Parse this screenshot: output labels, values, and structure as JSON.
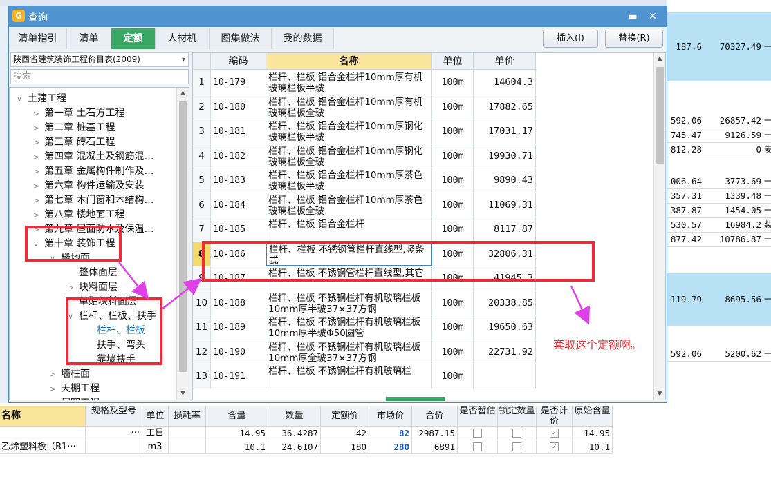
{
  "dialog": {
    "title": "查询",
    "minimize_glyph": "▬",
    "close_glyph": "✕",
    "tabs": [
      "清单指引",
      "清单",
      "定额",
      "人材机",
      "图集做法",
      "我的数据"
    ],
    "active_tab": 2,
    "insert_label": "插入(I)",
    "replace_label": "替换(R)"
  },
  "left_panel": {
    "catalog_select": "陕西省建筑装饰工程价目表(2009)",
    "search_placeholder": "搜索",
    "tree": [
      {
        "label": "土建工程",
        "level": 0,
        "expander": "∨"
      },
      {
        "label": "第一章  土石方工程",
        "level": 1,
        "expander": ">"
      },
      {
        "label": "第二章  桩基工程",
        "level": 1,
        "expander": ">"
      },
      {
        "label": "第三章  砖石工程",
        "level": 1,
        "expander": ">"
      },
      {
        "label": "第四章  混凝土及钢筋混…",
        "level": 1,
        "expander": ">"
      },
      {
        "label": "第五章  金属构件制作及…",
        "level": 1,
        "expander": ">"
      },
      {
        "label": "第六章  构件运输及安装",
        "level": 1,
        "expander": ">"
      },
      {
        "label": "第七章  木门窗和木结构…",
        "level": 1,
        "expander": ">"
      },
      {
        "label": "第八章  楼地面工程",
        "level": 1,
        "expander": ">"
      },
      {
        "label": "第九章  屋面防水及保温…",
        "level": 1,
        "expander": ">"
      },
      {
        "label": "第十章  装饰工程",
        "level": 1,
        "expander": "∨"
      },
      {
        "label": "楼地面",
        "level": 2,
        "expander": "∨"
      },
      {
        "label": "整体面层",
        "level": 3,
        "expander": ""
      },
      {
        "label": "块料面层",
        "level": 3,
        "expander": ">"
      },
      {
        "label": "单贴块料面层",
        "level": 3,
        "expander": ""
      },
      {
        "label": "栏杆、栏板、扶手",
        "level": 3,
        "expander": "∨"
      },
      {
        "label": "栏杆、栏板",
        "level": 4,
        "expander": "",
        "selected": true
      },
      {
        "label": "扶手、弯头",
        "level": 4,
        "expander": ""
      },
      {
        "label": "靠墙扶手",
        "level": 4,
        "expander": ""
      },
      {
        "label": "墙柱面",
        "level": 2,
        "expander": ">"
      },
      {
        "label": "天棚工程",
        "level": 2,
        "expander": ">"
      },
      {
        "label": "门窗工程",
        "level": 2,
        "expander": ">"
      }
    ]
  },
  "grid": {
    "headers": [
      "",
      "编码",
      "名称",
      "单位",
      "单价"
    ],
    "rows": [
      {
        "num": "1",
        "code": "10-179",
        "name": "栏杆、栏板 铝合金栏杆10mm厚有机玻璃栏板半玻",
        "unit": "100m",
        "price": "14604.3"
      },
      {
        "num": "2",
        "code": "10-180",
        "name": "栏杆、栏板 铝合金栏杆10mm厚有机玻璃栏板全玻",
        "unit": "100m",
        "price": "17882.65"
      },
      {
        "num": "3",
        "code": "10-181",
        "name": "栏杆、栏板 铝合金栏杆10mm厚钢化玻璃栏板半玻",
        "unit": "100m",
        "price": "17031.17"
      },
      {
        "num": "4",
        "code": "10-182",
        "name": "栏杆、栏板 铝合金栏杆10mm厚钢化玻璃栏板全玻",
        "unit": "100m",
        "price": "19930.71"
      },
      {
        "num": "5",
        "code": "10-183",
        "name": "栏杆、栏板 铝合金栏杆10mm厚茶色玻璃栏板半玻",
        "unit": "100m",
        "price": "9890.43"
      },
      {
        "num": "6",
        "code": "10-184",
        "name": "栏杆、栏板 铝合金栏杆10mm厚茶色玻璃栏板全玻",
        "unit": "100m",
        "price": "11069.31"
      },
      {
        "num": "7",
        "code": "10-185",
        "name": "栏杆、栏板 铝合金栏杆",
        "unit": "100m",
        "price": "8117.87"
      },
      {
        "num": "8",
        "code": "10-186",
        "name": "栏杆、栏板 不锈钢管栏杆直线型,竖条式",
        "unit": "100m",
        "price": "32806.31",
        "selected": true
      },
      {
        "num": "9",
        "code": "10-187",
        "name": "栏杆、栏板 不锈钢管栏杆直线型,其它",
        "unit": "100m",
        "price": "41945.3"
      },
      {
        "num": "10",
        "code": "10-188",
        "name": "栏杆、栏板 不锈钢栏杆有机玻璃栏板10mm厚半玻37×37方钢",
        "unit": "100m",
        "price": "20338.85"
      },
      {
        "num": "11",
        "code": "10-189",
        "name": "栏杆、栏板 不锈钢栏杆有机玻璃栏板10mm厚半玻Φ50圆管",
        "unit": "100m",
        "price": "19650.63"
      },
      {
        "num": "12",
        "code": "10-190",
        "name": "栏杆、栏板 不锈钢栏杆有机玻璃栏板10mm厚全玻37×37方钢",
        "unit": "100m",
        "price": "22731.92"
      },
      {
        "num": "13",
        "code": "10-191",
        "name": "栏杆、栏板 不锈钢栏杆有机玻璃栏",
        "unit": "100m",
        "price": ""
      }
    ]
  },
  "annotation": {
    "note": "套取这个定额啊。",
    "color": "#ef2b3a",
    "arrow_color": "#e040e8"
  },
  "background_right": {
    "rows": [
      {
        "c1": "187.6",
        "c2": "70327.49",
        "c3": "一",
        "blue": true
      },
      {
        "c1": "592.06",
        "c2": "26857.42",
        "c3": "一"
      },
      {
        "c1": "745.47",
        "c2": "9126.59",
        "c3": "一"
      },
      {
        "c1": "812.28",
        "c2": "0",
        "c3": "安"
      },
      {
        "c1": "006.64",
        "c2": "3773.69",
        "c3": "一"
      },
      {
        "c1": "357.31",
        "c2": "1339.48",
        "c3": "一"
      },
      {
        "c1": "387.87",
        "c2": "1454.05",
        "c3": "一"
      },
      {
        "c1": "530.57",
        "c2": "16984.2",
        "c3": "装"
      },
      {
        "c1": "877.42",
        "c2": "10786.87",
        "c3": "一"
      },
      {
        "c1": "119.79",
        "c2": "8695.56",
        "c3": "一",
        "blue": true
      },
      {
        "c1": "592.06",
        "c2": "5200.62",
        "c3": "一"
      }
    ]
  },
  "bottom_table": {
    "headers": [
      "名称",
      "规格及型号",
      "单位",
      "损耗率",
      "含量",
      "数量",
      "定额价",
      "市场价",
      "合价",
      "是否暂估",
      "锁定数量",
      "是否计价",
      "原始含量"
    ],
    "rows": [
      {
        "name": "",
        "spec": "···",
        "unit": "工日",
        "loss": "",
        "content": "14.95",
        "qty": "36.4287",
        "quota": "42",
        "market": "82",
        "total": "2987.15",
        "provisional": false,
        "locked": false,
        "priced": true,
        "orig": "14.95"
      },
      {
        "name": "乙烯塑料板（B1···",
        "spec": "",
        "unit": "m3",
        "loss": "",
        "content": "10.1",
        "qty": "24.6107",
        "quota": "180",
        "market": "280",
        "total": "6891",
        "provisional": false,
        "locked": false,
        "priced": true,
        "orig": "10.1"
      }
    ]
  }
}
